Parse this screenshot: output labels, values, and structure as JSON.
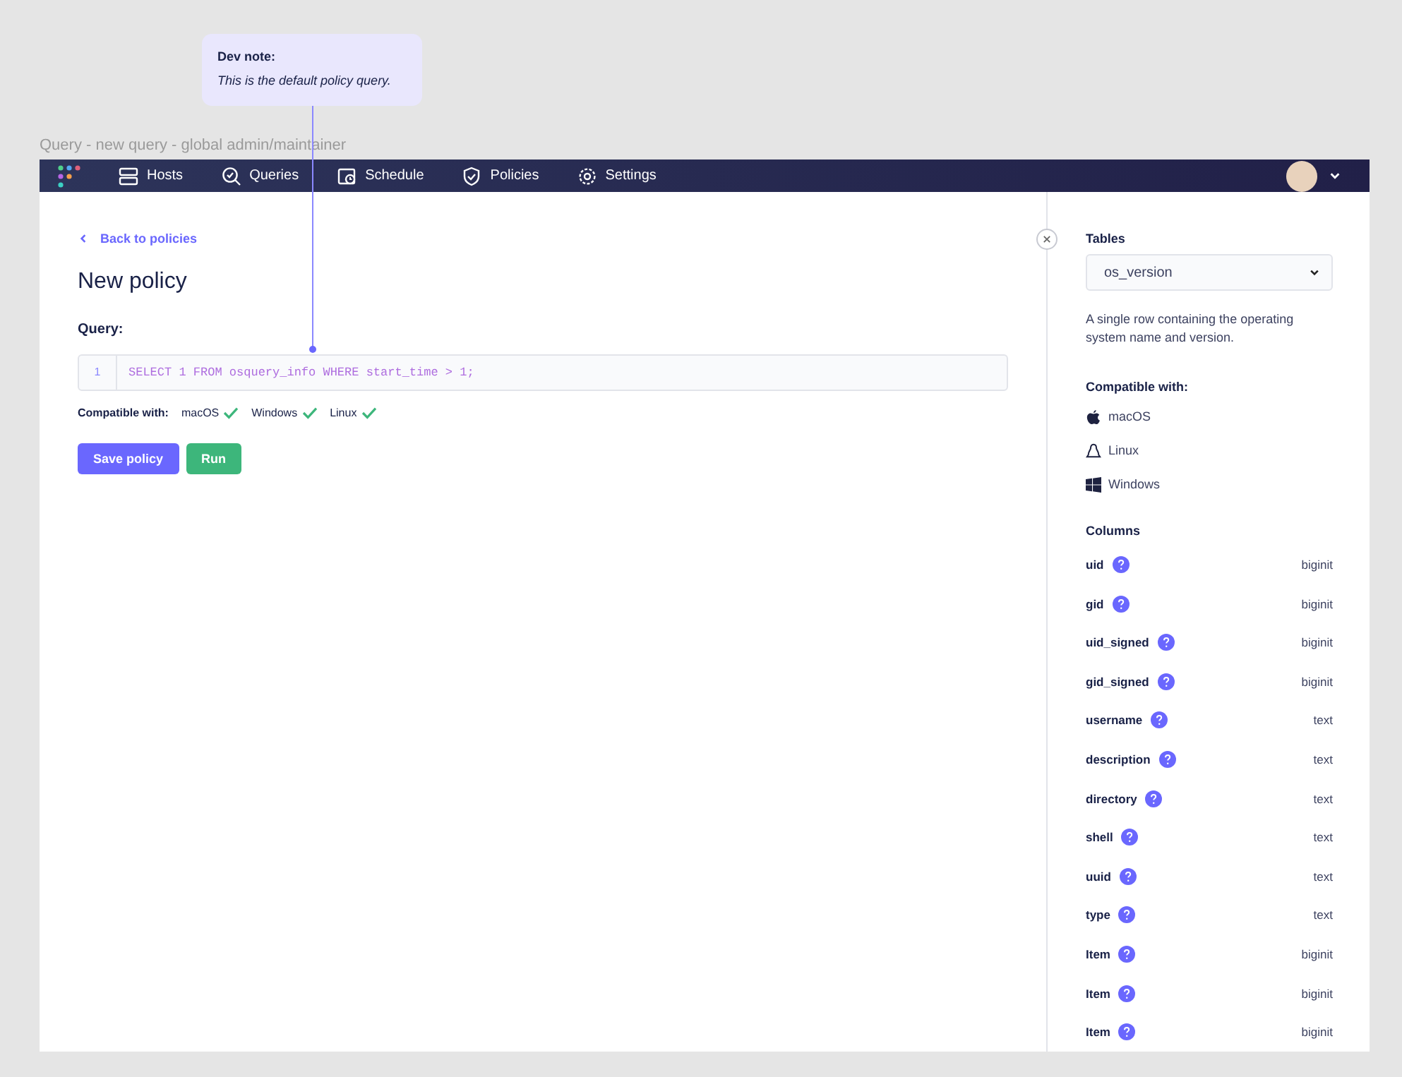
{
  "dev_note": {
    "title": "Dev note:",
    "text": "This is the default policy query."
  },
  "frame_title": "Query - new query - global admin/maintainer",
  "nav": {
    "items": [
      {
        "label": "Hosts",
        "kind": "hosts"
      },
      {
        "label": "Queries",
        "kind": "queries"
      },
      {
        "label": "Schedule",
        "kind": "schedule"
      },
      {
        "label": "Policies",
        "kind": "policies"
      },
      {
        "label": "Settings",
        "kind": "settings"
      }
    ]
  },
  "main": {
    "back_link": "Back to policies",
    "heading": "New policy",
    "query_label": "Query:",
    "editor": {
      "line_number": "1",
      "code": "SELECT 1 FROM osquery_info WHERE start_time > 1;"
    },
    "compatible_label": "Compatible with:",
    "platforms": [
      {
        "name": "macOS",
        "compatible": true
      },
      {
        "name": "Windows",
        "compatible": true
      },
      {
        "name": "Linux",
        "compatible": true
      }
    ],
    "buttons": [
      {
        "label": "Save policy",
        "kind": "primary"
      },
      {
        "label": "Run",
        "kind": "success"
      }
    ]
  },
  "sidebar": {
    "tables_label": "Tables",
    "table_select": "os_version",
    "description": "A single row containing the operating system name and version.",
    "compatible_label": "Compatible with:",
    "platforms": [
      {
        "name": "macOS",
        "kind": "macos"
      },
      {
        "name": "Linux",
        "kind": "linux"
      },
      {
        "name": "Windows",
        "kind": "windows"
      }
    ],
    "columns_label": "Columns",
    "columns": [
      {
        "name": "uid",
        "type": "biginit"
      },
      {
        "name": "gid",
        "type": "biginit"
      },
      {
        "name": "uid_signed",
        "type": "biginit"
      },
      {
        "name": "gid_signed",
        "type": "biginit"
      },
      {
        "name": "username",
        "type": "text"
      },
      {
        "name": "description",
        "type": "text"
      },
      {
        "name": "directory",
        "type": "text"
      },
      {
        "name": "shell",
        "type": "text"
      },
      {
        "name": "uuid",
        "type": "text"
      },
      {
        "name": "type",
        "type": "text"
      },
      {
        "name": "Item",
        "type": "biginit"
      },
      {
        "name": "Item",
        "type": "biginit"
      },
      {
        "name": "Item",
        "type": "biginit"
      }
    ]
  }
}
